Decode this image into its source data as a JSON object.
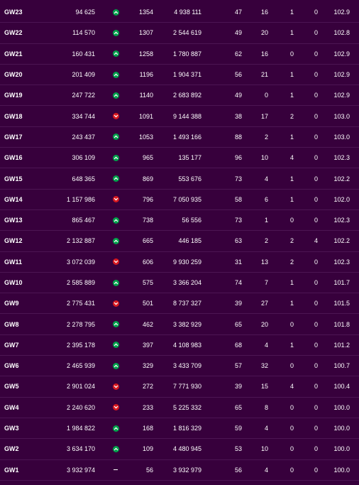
{
  "colors": {
    "background": "#37003c",
    "row_divider": "#4c1553",
    "up": "#01a14b",
    "down": "#d81920"
  },
  "rows": [
    {
      "gw": "GW23",
      "overall_rank": "94 625",
      "movement": "up",
      "gw_rank": "1354",
      "points": "4 938 111",
      "c5": "47",
      "c6": "16",
      "c7": "1",
      "c8": "0",
      "value": "102.9"
    },
    {
      "gw": "GW22",
      "overall_rank": "114 570",
      "movement": "up",
      "gw_rank": "1307",
      "points": "2 544 619",
      "c5": "49",
      "c6": "20",
      "c7": "1",
      "c8": "0",
      "value": "102.8"
    },
    {
      "gw": "GW21",
      "overall_rank": "160 431",
      "movement": "up",
      "gw_rank": "1258",
      "points": "1 780 887",
      "c5": "62",
      "c6": "16",
      "c7": "0",
      "c8": "0",
      "value": "102.9"
    },
    {
      "gw": "GW20",
      "overall_rank": "201 409",
      "movement": "up",
      "gw_rank": "1196",
      "points": "1 904 371",
      "c5": "56",
      "c6": "21",
      "c7": "1",
      "c8": "0",
      "value": "102.9"
    },
    {
      "gw": "GW19",
      "overall_rank": "247 722",
      "movement": "up",
      "gw_rank": "1140",
      "points": "2 683 892",
      "c5": "49",
      "c6": "0",
      "c7": "1",
      "c8": "0",
      "value": "102.9"
    },
    {
      "gw": "GW18",
      "overall_rank": "334 744",
      "movement": "down",
      "gw_rank": "1091",
      "points": "9 144 388",
      "c5": "38",
      "c6": "17",
      "c7": "2",
      "c8": "0",
      "value": "103.0"
    },
    {
      "gw": "GW17",
      "overall_rank": "243 437",
      "movement": "up",
      "gw_rank": "1053",
      "points": "1 493 166",
      "c5": "88",
      "c6": "2",
      "c7": "1",
      "c8": "0",
      "value": "103.0"
    },
    {
      "gw": "GW16",
      "overall_rank": "306 109",
      "movement": "up",
      "gw_rank": "965",
      "points": "135 177",
      "c5": "96",
      "c6": "10",
      "c7": "4",
      "c8": "0",
      "value": "102.3"
    },
    {
      "gw": "GW15",
      "overall_rank": "648 365",
      "movement": "up",
      "gw_rank": "869",
      "points": "553 676",
      "c5": "73",
      "c6": "4",
      "c7": "1",
      "c8": "0",
      "value": "102.2"
    },
    {
      "gw": "GW14",
      "overall_rank": "1 157 986",
      "movement": "down",
      "gw_rank": "796",
      "points": "7 050 935",
      "c5": "58",
      "c6": "6",
      "c7": "1",
      "c8": "0",
      "value": "102.0"
    },
    {
      "gw": "GW13",
      "overall_rank": "865 467",
      "movement": "up",
      "gw_rank": "738",
      "points": "56 556",
      "c5": "73",
      "c6": "1",
      "c7": "0",
      "c8": "0",
      "value": "102.3"
    },
    {
      "gw": "GW12",
      "overall_rank": "2 132 887",
      "movement": "up",
      "gw_rank": "665",
      "points": "446 185",
      "c5": "63",
      "c6": "2",
      "c7": "2",
      "c8": "4",
      "value": "102.2"
    },
    {
      "gw": "GW11",
      "overall_rank": "3 072 039",
      "movement": "down",
      "gw_rank": "606",
      "points": "9 930 259",
      "c5": "31",
      "c6": "13",
      "c7": "2",
      "c8": "0",
      "value": "102.3"
    },
    {
      "gw": "GW10",
      "overall_rank": "2 585 889",
      "movement": "up",
      "gw_rank": "575",
      "points": "3 366 204",
      "c5": "74",
      "c6": "7",
      "c7": "1",
      "c8": "0",
      "value": "101.7"
    },
    {
      "gw": "GW9",
      "overall_rank": "2 775 431",
      "movement": "down",
      "gw_rank": "501",
      "points": "8 737 327",
      "c5": "39",
      "c6": "27",
      "c7": "1",
      "c8": "0",
      "value": "101.5"
    },
    {
      "gw": "GW8",
      "overall_rank": "2 278 795",
      "movement": "up",
      "gw_rank": "462",
      "points": "3 382 929",
      "c5": "65",
      "c6": "20",
      "c7": "0",
      "c8": "0",
      "value": "101.8"
    },
    {
      "gw": "GW7",
      "overall_rank": "2 395 178",
      "movement": "up",
      "gw_rank": "397",
      "points": "4 108 983",
      "c5": "68",
      "c6": "4",
      "c7": "1",
      "c8": "0",
      "value": "101.2"
    },
    {
      "gw": "GW6",
      "overall_rank": "2 465 939",
      "movement": "up",
      "gw_rank": "329",
      "points": "3 433 709",
      "c5": "57",
      "c6": "32",
      "c7": "0",
      "c8": "0",
      "value": "100.7"
    },
    {
      "gw": "GW5",
      "overall_rank": "2 901 024",
      "movement": "down",
      "gw_rank": "272",
      "points": "7 771 930",
      "c5": "39",
      "c6": "15",
      "c7": "4",
      "c8": "0",
      "value": "100.4"
    },
    {
      "gw": "GW4",
      "overall_rank": "2 240 620",
      "movement": "down",
      "gw_rank": "233",
      "points": "5 225 332",
      "c5": "65",
      "c6": "8",
      "c7": "0",
      "c8": "0",
      "value": "100.0"
    },
    {
      "gw": "GW3",
      "overall_rank": "1 984 822",
      "movement": "up",
      "gw_rank": "168",
      "points": "1 816 329",
      "c5": "59",
      "c6": "4",
      "c7": "0",
      "c8": "0",
      "value": "100.0"
    },
    {
      "gw": "GW2",
      "overall_rank": "3 634 170",
      "movement": "up",
      "gw_rank": "109",
      "points": "4 480 945",
      "c5": "53",
      "c6": "10",
      "c7": "0",
      "c8": "0",
      "value": "100.0"
    },
    {
      "gw": "GW1",
      "overall_rank": "3 932 974",
      "movement": "none",
      "gw_rank": "56",
      "points": "3 932 979",
      "c5": "56",
      "c6": "4",
      "c7": "0",
      "c8": "0",
      "value": "100.0"
    }
  ]
}
